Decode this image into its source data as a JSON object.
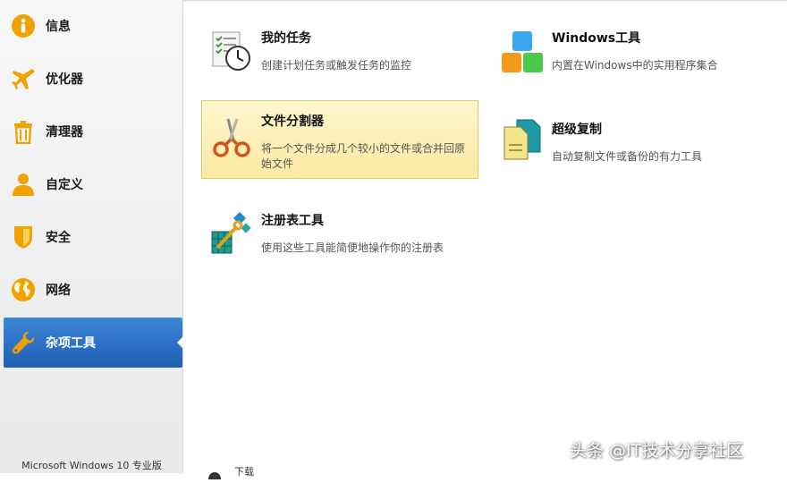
{
  "sidebar": {
    "items": [
      {
        "label": "信息",
        "icon": "info-icon"
      },
      {
        "label": "优化器",
        "icon": "airplane-icon"
      },
      {
        "label": "清理器",
        "icon": "trash-icon"
      },
      {
        "label": "自定义",
        "icon": "user-icon"
      },
      {
        "label": "安全",
        "icon": "shield-icon"
      },
      {
        "label": "网络",
        "icon": "globe-icon"
      },
      {
        "label": "杂项工具",
        "icon": "wrench-icon",
        "active": true
      }
    ],
    "os_label": "Microsoft Windows 10 专业版"
  },
  "tools": [
    {
      "title": "我的任务",
      "description": "创建计划任务或触发任务的监控",
      "icon": "task-clock-icon"
    },
    {
      "title": "Windows工具",
      "description": "内置在Windows中的实用程序集合",
      "icon": "windows-tiles-icon"
    },
    {
      "title": "文件分割器",
      "description": "将一个文件分成几个较小的文件或合并回原始文件",
      "icon": "scissors-icon",
      "selected": true
    },
    {
      "title": "超级复制",
      "description": "自动复制文件或备份的有力工具",
      "icon": "copy-documents-icon"
    },
    {
      "title": "注册表工具",
      "description": "使用这些工具能简便地操作你的注册表",
      "icon": "registry-cubes-icon"
    }
  ],
  "partial_bottom_item": {
    "label": "下载"
  },
  "watermark": "头条 @IT技术分享社区",
  "colors": {
    "active_blue": "#2b6fc6",
    "selected_yellow": "#fdeaa5",
    "icon_orange": "#f2a200"
  }
}
